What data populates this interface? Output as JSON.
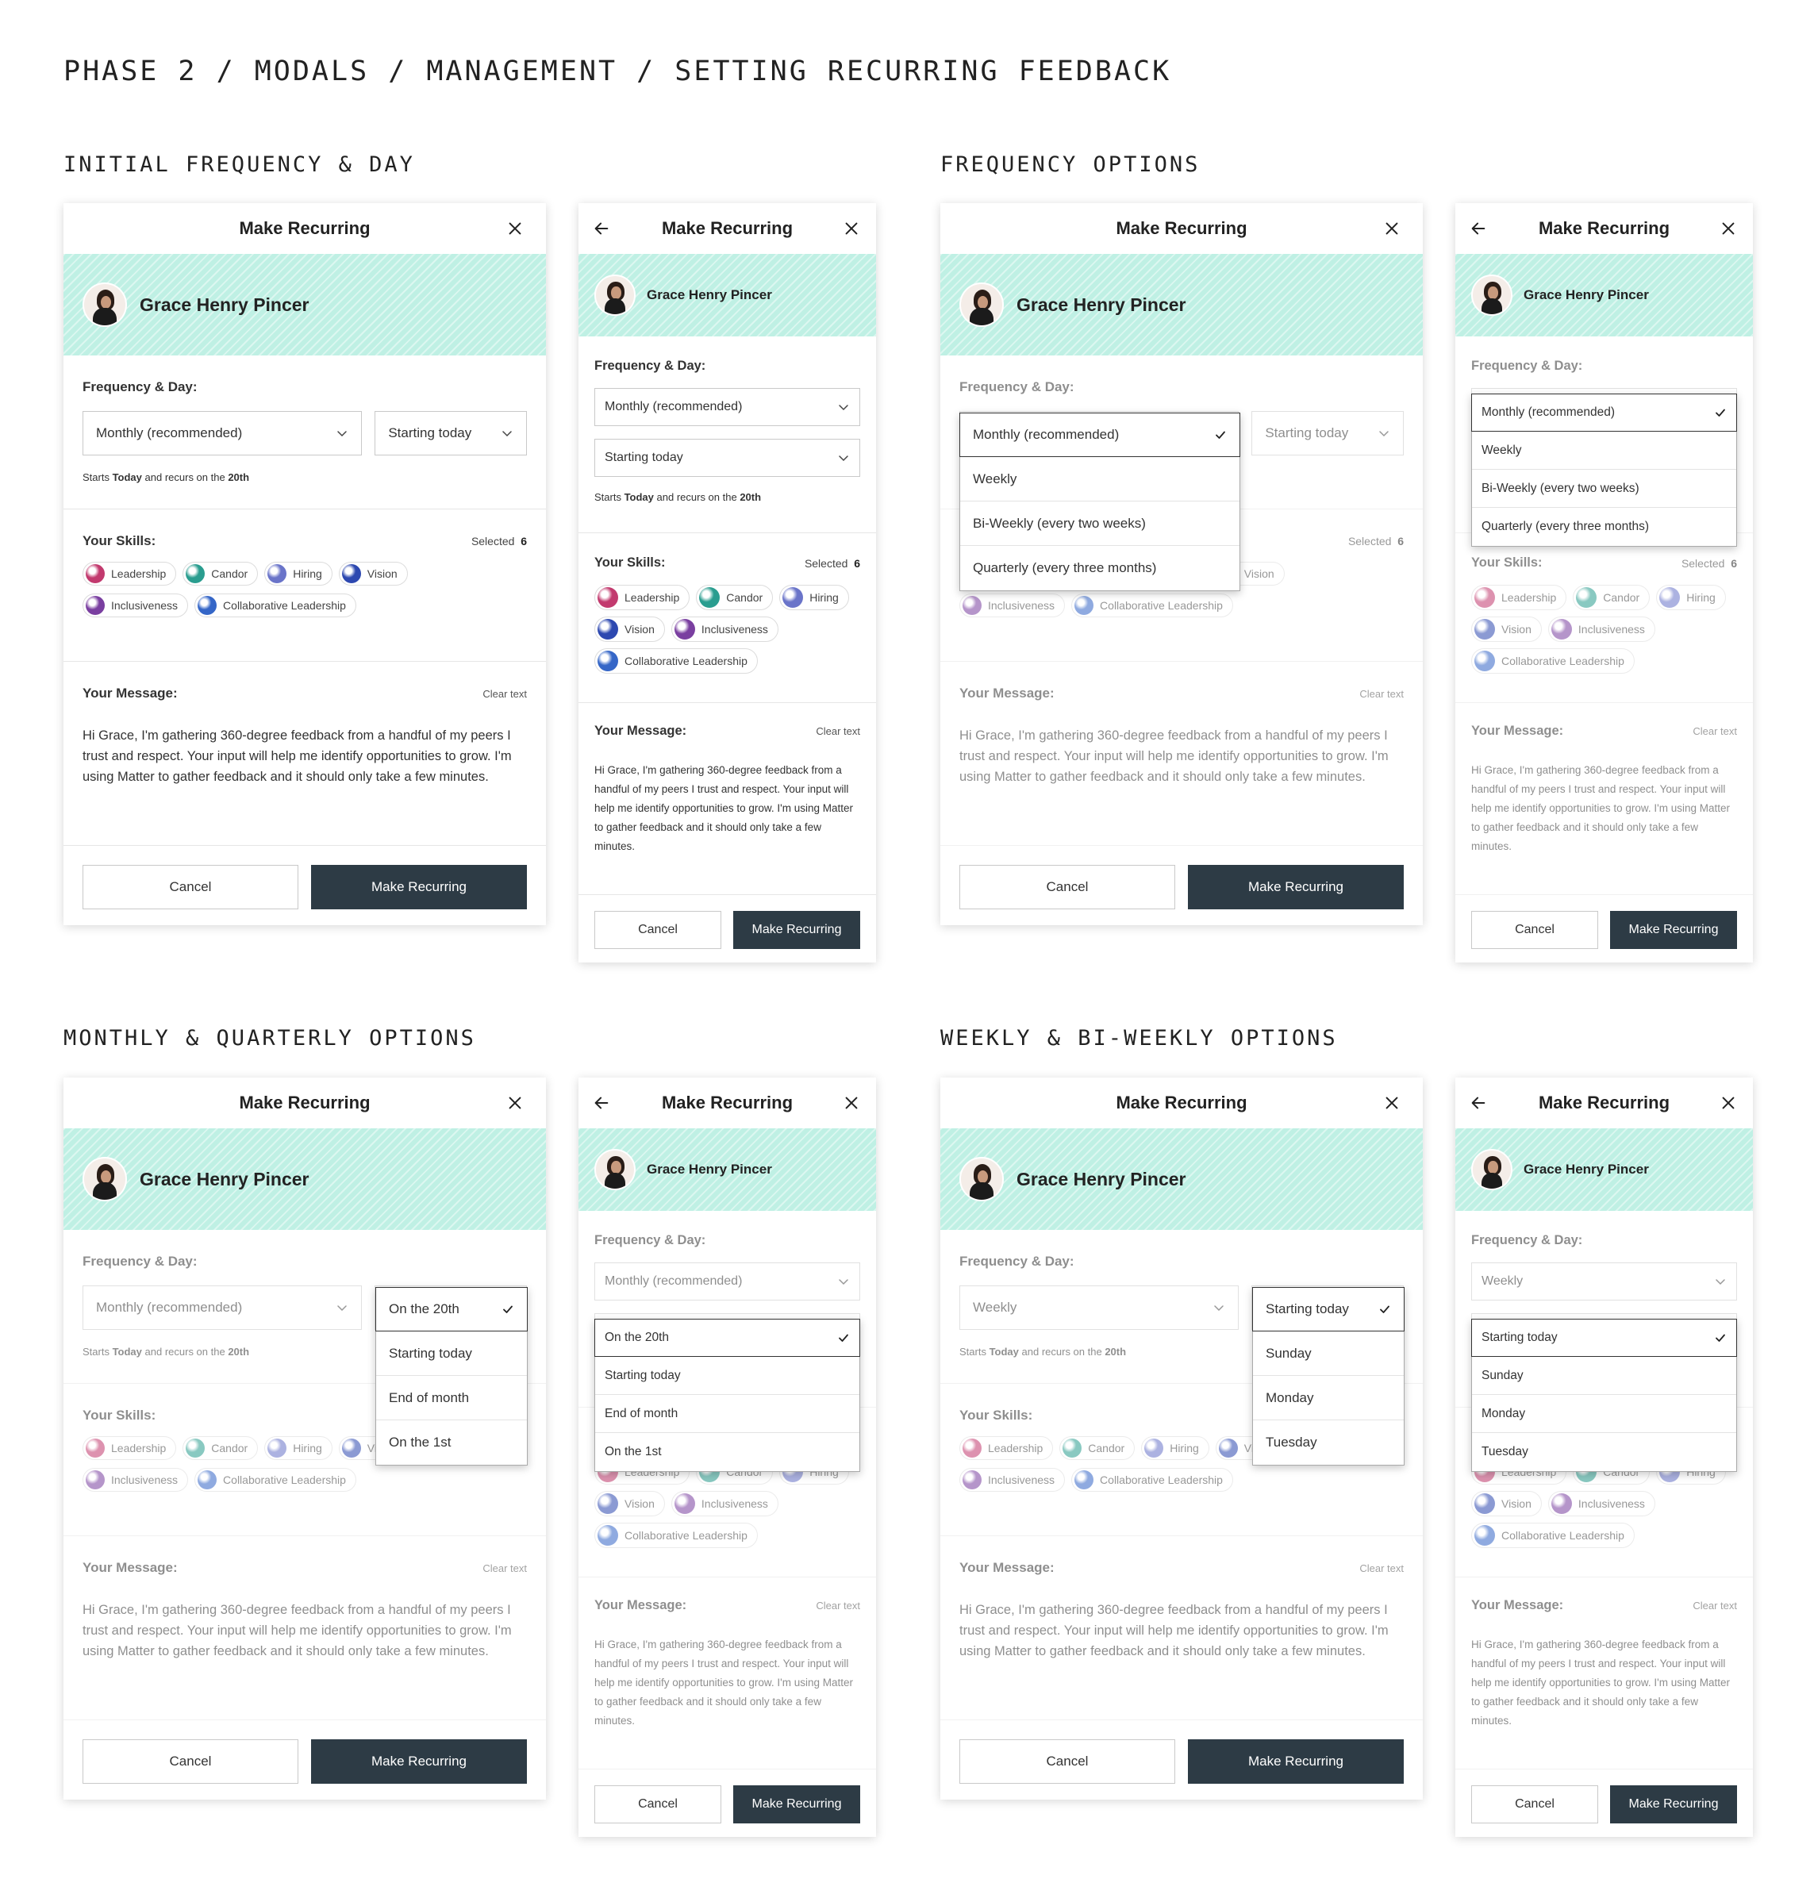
{
  "page_title": "PHASE 2 / MODALS / MANAGEMENT / SETTING RECURRING FEEDBACK",
  "sections": {
    "s1": "INITIAL FREQUENCY & DAY",
    "s2": "FREQUENCY OPTIONS",
    "s3": "MONTHLY & QUARTERLY OPTIONS",
    "s4": "WEEKLY & BI-WEEKLY OPTIONS"
  },
  "modal": {
    "title": "Make Recurring",
    "person_name": "Grace Henry Pincer",
    "freq_label": "Frequency & Day:",
    "hint_prefix": "Starts ",
    "hint_today": "Today",
    "hint_mid": " and recurs on the ",
    "hint_day": "20th",
    "skills_label": "Your Skills:",
    "selected_label": "Selected",
    "selected_count": "6",
    "message_label": "Your Message:",
    "clear_text": "Clear text",
    "message": "Hi Grace, I'm gathering 360-degree feedback from a handful of my peers I trust and respect. Your input will help me identify opportunities to grow. I'm using Matter to gather feedback and it should only take a few minutes.",
    "cancel": "Cancel",
    "submit": "Make Recurring"
  },
  "skills": [
    "Leadership",
    "Candor",
    "Hiring",
    "Vision",
    "Inclusiveness",
    "Collaborative Leadership"
  ],
  "colors": {
    "primary": "#2d3b45",
    "hero_bg": "#bff0e4",
    "leadership": "#c23a6e",
    "candor": "#2a9d8f",
    "hiring": "#6a74c9",
    "vision": "#2d48b0",
    "inclusiveness": "#7a3fa0",
    "collaborative": "#3566c7"
  },
  "values": {
    "monthly": "Monthly (recommended)",
    "weekly": "Weekly",
    "starting_today": "Starting today"
  },
  "frequency_options": [
    "Monthly (recommended)",
    "Weekly",
    "Bi-Weekly (every two weeks)",
    "Quarterly (every three months)"
  ],
  "monthly_day_options": [
    "On the 20th",
    "Starting today",
    "End of month",
    "On the 1st"
  ],
  "weekly_day_options": [
    "Starting today",
    "Sunday",
    "Monday",
    "Tuesday"
  ]
}
